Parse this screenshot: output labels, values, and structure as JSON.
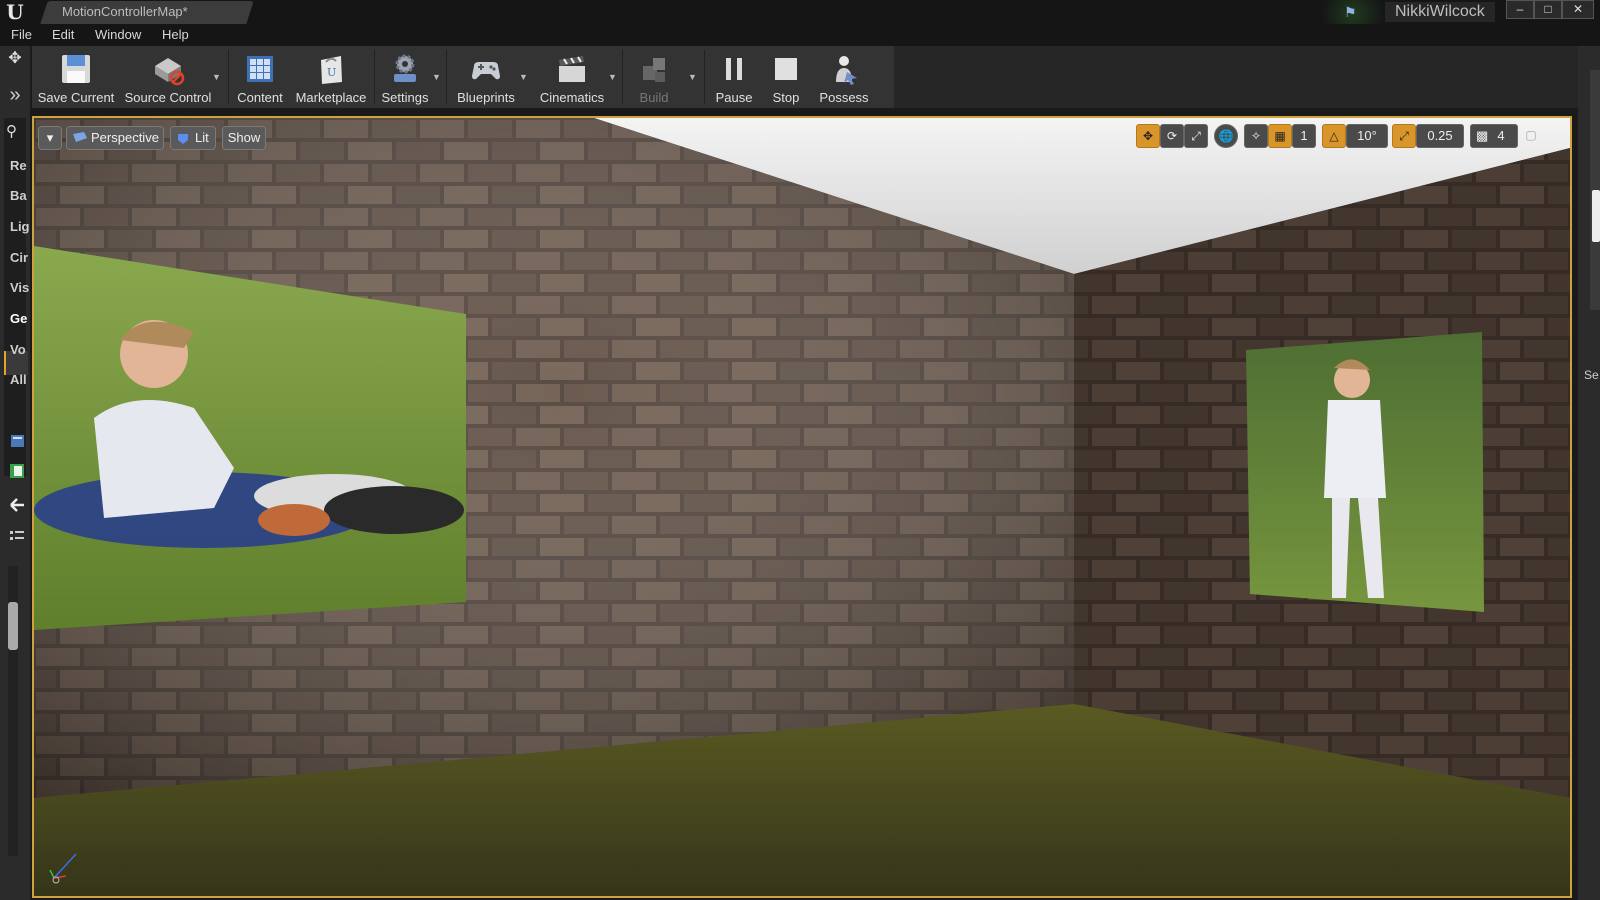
{
  "window": {
    "app_logo": "U",
    "document_tab": "MotionControllerMap*",
    "user_name": "NikkiWilcock",
    "minimize": "–",
    "maximize": "□",
    "close": "✕"
  },
  "menu": [
    "File",
    "Edit",
    "Window",
    "Help"
  ],
  "toolbar": {
    "buttons": [
      {
        "label": "Save Current",
        "icon": "floppy-disk-icon"
      },
      {
        "label": "Source Control",
        "icon": "source-control-icon"
      },
      {
        "label": "Content",
        "icon": "content-grid-icon"
      },
      {
        "label": "Marketplace",
        "icon": "marketplace-bag-icon"
      },
      {
        "label": "Settings",
        "icon": "settings-gears-icon"
      },
      {
        "label": "Blueprints",
        "icon": "gamepad-icon"
      },
      {
        "label": "Cinematics",
        "icon": "clapperboard-icon"
      },
      {
        "label": "Build",
        "icon": "build-cubes-icon",
        "disabled": true
      },
      {
        "label": "Pause",
        "icon": "pause-icon"
      },
      {
        "label": "Stop",
        "icon": "stop-icon"
      },
      {
        "label": "Possess",
        "icon": "possess-pawn-icon"
      }
    ]
  },
  "left_panel": {
    "categories": [
      "Re",
      "Ba",
      "Lig",
      "Cir",
      "Vis",
      "Ge",
      "Vo",
      "All"
    ],
    "active": "Ge"
  },
  "right_panel": {
    "partial_label": "Se"
  },
  "viewport": {
    "options_arrow": "▾",
    "view_mode": "Perspective",
    "lighting_mode": "Lit",
    "show_label": "Show",
    "grid_snap_value": "1",
    "rotation_snap_value": "10°",
    "scale_snap_value": "0.25",
    "camera_speed_value": "4",
    "accent_color": "#d9952a"
  },
  "colors": {
    "viewport_border": "#cfa240",
    "toolbar_bg": "#333333",
    "titlebar_bg": "#151515"
  }
}
